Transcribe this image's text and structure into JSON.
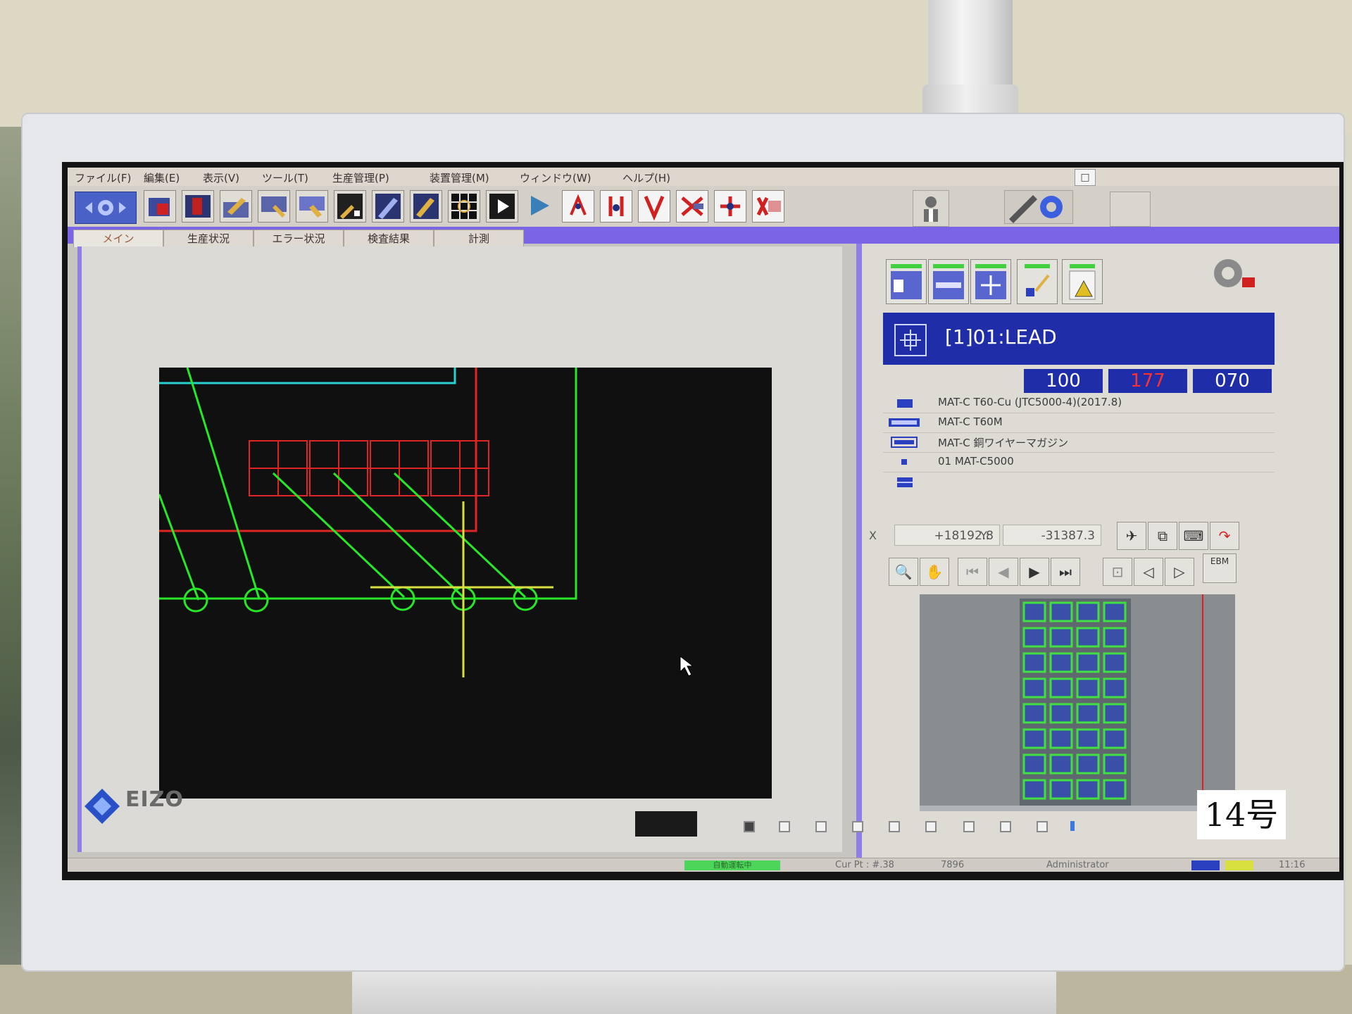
{
  "monitor": {
    "brand": "EIZO",
    "sticker": "14号"
  },
  "menu": {
    "items": [
      "ファイル(F)",
      "編集(E)",
      "表示(V)",
      "ツール(T)",
      "生産管理(P)",
      "装置管理(M)",
      "ウィンドウ(W)",
      "ヘルプ(H)"
    ],
    "restore_glyph": "□"
  },
  "toolbar": {
    "icons": [
      "setup-icon",
      "part-red-icon",
      "part-board-icon",
      "part-tools-icon",
      "part-pick-icon",
      "part-place-icon",
      "part-nozzle-icon",
      "part-feeder-icon",
      "part-chip-icon",
      "grid-icon",
      "play-film-icon",
      "run-icon",
      "tool-1-icon",
      "tool-2-icon",
      "tool-3-icon",
      "tool-4-icon",
      "tool-5-icon",
      "tool-6-icon"
    ]
  },
  "tabs": [
    "メイン",
    "生産状況",
    "エラー状況",
    "検査結果",
    "計測"
  ],
  "program": {
    "title": "[1]01:LEAD",
    "counters": [
      "100",
      "177",
      "070"
    ],
    "counter_colors": [
      "#ffffff",
      "#ff3030",
      "#ffffff"
    ]
  },
  "info_rows": [
    {
      "icon": "folder-icon",
      "text": "MAT-C T60-Cu (JTC5000-4)(2017.8)"
    },
    {
      "icon": "board-icon",
      "text": "MAT-C T60M"
    },
    {
      "icon": "magazine-icon",
      "text": "MAT-C 銅ワイヤーマガジン"
    },
    {
      "icon": "chip-icon",
      "text": "01 MAT-C5000"
    },
    {
      "icon": "block-icon",
      "text": ""
    }
  ],
  "coords": {
    "x_label": "X",
    "x_value": "+18192.8",
    "y_label": "Y:",
    "y_value": "-31387.3"
  },
  "preview_controls": {
    "ebm_label": "EBM"
  },
  "statusbar": {
    "green_status": "自動運転中",
    "cur_pt": "Cur Pt : #.38",
    "code": "7896",
    "user": "Administrator",
    "time": "11:16"
  },
  "colors": {
    "accent": "#7b65e6",
    "title_blue": "#1f2ea8",
    "cad_green": "#28e628",
    "cad_red": "#e02424",
    "cad_cyan": "#2ad0d0",
    "cad_yellow": "#d8e040"
  }
}
